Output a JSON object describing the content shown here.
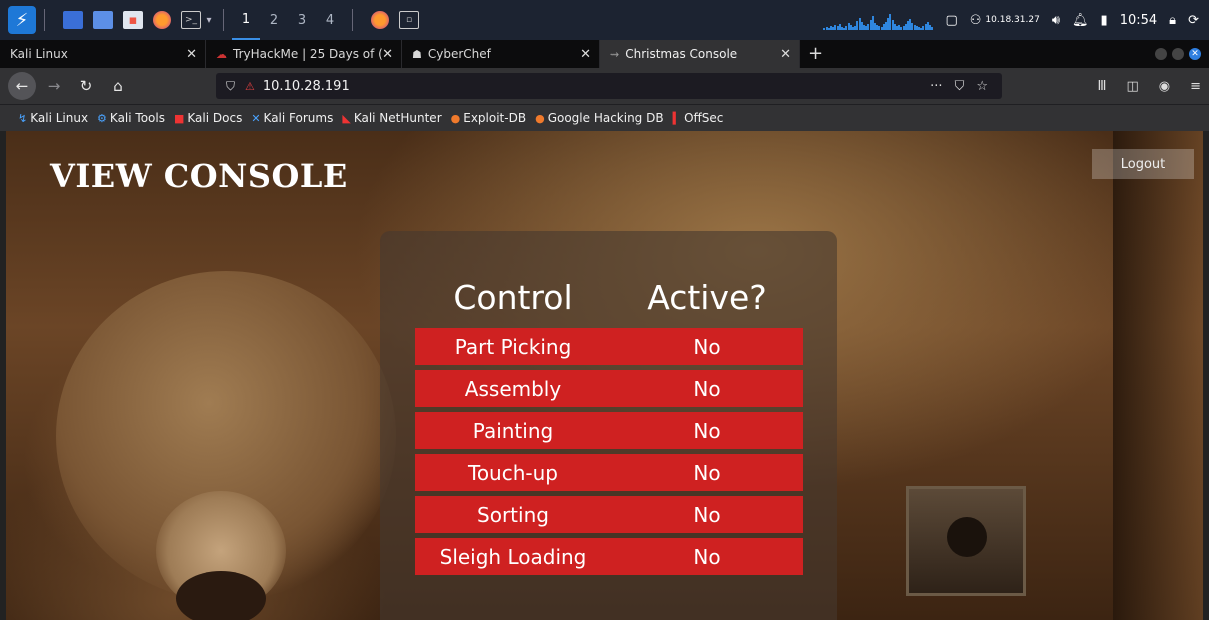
{
  "panel": {
    "workspaces": [
      "1",
      "2",
      "3",
      "4"
    ],
    "ip": "10.18.31.27",
    "time": "10:54"
  },
  "tabs": [
    {
      "label": "Kali Linux",
      "icon": "none"
    },
    {
      "label": "TryHackMe | 25 Days of (",
      "icon": "tryhackme-icon"
    },
    {
      "label": "CyberChef",
      "icon": "chef-hat-icon"
    },
    {
      "label": "Christmas Console",
      "icon": "page-icon"
    }
  ],
  "nav": {
    "url": "10.10.28.191"
  },
  "bookmarks": [
    {
      "label": "Kali Linux",
      "icon": "kali-icon"
    },
    {
      "label": "Kali Tools",
      "icon": "kali-tools-icon"
    },
    {
      "label": "Kali Docs",
      "icon": "kali-docs-icon"
    },
    {
      "label": "Kali Forums",
      "icon": "kali-forums-icon"
    },
    {
      "label": "Kali NetHunter",
      "icon": "nethunter-icon"
    },
    {
      "label": "Exploit-DB",
      "icon": "exploit-db-icon"
    },
    {
      "label": "Google Hacking DB",
      "icon": "ghdb-icon"
    },
    {
      "label": "OffSec",
      "icon": "offsec-icon"
    }
  ],
  "page": {
    "title": "VIEW CONSOLE",
    "logout_label": "Logout",
    "table": {
      "headers": [
        "Control",
        "Active?"
      ],
      "rows": [
        {
          "control": "Part Picking",
          "active": "No"
        },
        {
          "control": "Assembly",
          "active": "No"
        },
        {
          "control": "Painting",
          "active": "No"
        },
        {
          "control": "Touch-up",
          "active": "No"
        },
        {
          "control": "Sorting",
          "active": "No"
        },
        {
          "control": "Sleigh Loading",
          "active": "No"
        }
      ]
    },
    "colors": {
      "row_background": "#cf2121",
      "text": "#ffffff"
    }
  }
}
